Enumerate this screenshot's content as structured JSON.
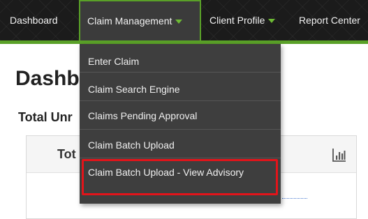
{
  "nav": {
    "items": [
      {
        "label": "Dashboard",
        "has_caret": false
      },
      {
        "label": "Claim Management",
        "has_caret": true,
        "active": true
      },
      {
        "label": "Client Profile",
        "has_caret": true
      },
      {
        "label": "Report Center",
        "has_caret": false
      }
    ],
    "accent_color": "#5aa128"
  },
  "dropdown": {
    "items": [
      {
        "label": "Enter Claim"
      },
      {
        "label": "Claim Search Engine"
      },
      {
        "label": "Claims Pending Approval"
      },
      {
        "label": "Claim Batch Upload"
      },
      {
        "label": "Claim Batch Upload - View Advisory",
        "highlighted": true
      }
    ],
    "highlight_color": "#e3141a"
  },
  "main": {
    "page_title": "Dashb",
    "section_title": "Total Unr",
    "panel": {
      "title": "Tot",
      "icon": "bar-chart-icon"
    }
  }
}
